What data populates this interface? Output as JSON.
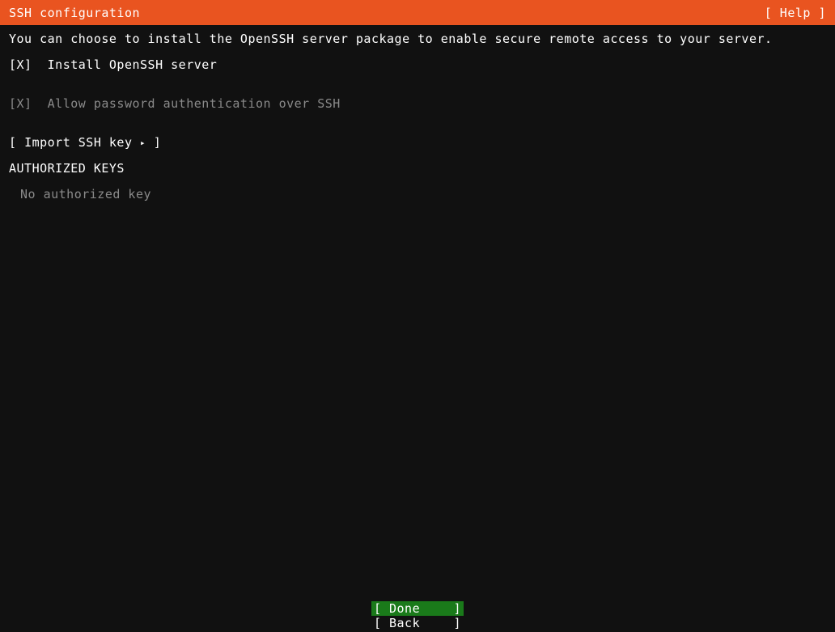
{
  "header": {
    "title": "SSH configuration",
    "help_label": "[ Help ]"
  },
  "main": {
    "intro_text": "You can choose to install the OpenSSH server package to enable secure remote access to your server.",
    "checkboxes": [
      {
        "marker": "[X]",
        "label": "Install OpenSSH server",
        "checked": true,
        "enabled": true
      },
      {
        "marker": "[X]",
        "label": "Allow password authentication over SSH",
        "checked": true,
        "enabled": false
      }
    ],
    "import_key": {
      "open_bracket": "[",
      "label": "Import SSH key",
      "arrow": "▸",
      "close_bracket": "]"
    },
    "authorized_keys": {
      "heading": "AUTHORIZED KEYS",
      "empty_text": "No authorized key"
    }
  },
  "footer": {
    "buttons": [
      {
        "open_bracket": "[",
        "label": "Done",
        "close_bracket": "]",
        "selected": true
      },
      {
        "open_bracket": "[",
        "label": "Back",
        "close_bracket": "]",
        "selected": false
      }
    ]
  },
  "colors": {
    "header_background": "#e95420",
    "screen_background": "#111111",
    "text_primary": "#ffffff",
    "text_dimmed": "#8a8a8a",
    "selection_background": "#1a7a1a"
  }
}
